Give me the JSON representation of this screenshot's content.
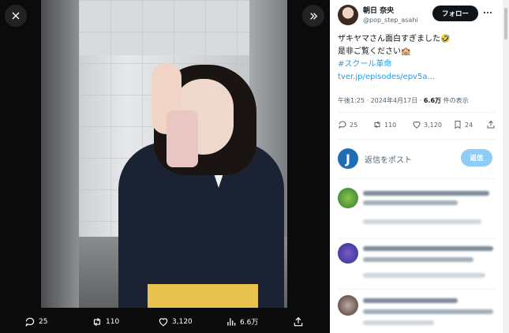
{
  "viewer": {
    "close_icon": "close-icon",
    "next_icon": "chevron-right-double-icon",
    "actions": {
      "replies": "25",
      "retweets": "110",
      "likes": "3,120",
      "views": "6.6万"
    }
  },
  "author": {
    "name": "朝日 奈央",
    "handle": "@pop_step_asahi",
    "follow_label": "フォロー"
  },
  "tweet": {
    "line1": "ザキヤマさん面白すぎました🤣",
    "line2": "是非ご覧ください🏫",
    "hashtag": "#スクール革命",
    "link": "tver.jp/episodes/epv5a...",
    "time": "午後1:25 · 2024年4月17日 · ",
    "views_count": "6.6万",
    "views_label": " 件の表示"
  },
  "stats": {
    "replies": "25",
    "retweets": "110",
    "likes": "3,120",
    "bookmarks": "24"
  },
  "reply_box": {
    "placeholder": "返信をポスト",
    "button_label": "返信"
  },
  "colors": {
    "accent": "#1d9bf0",
    "reply_button_disabled": "#8ecdf8",
    "follow_button": "#0f1419"
  }
}
